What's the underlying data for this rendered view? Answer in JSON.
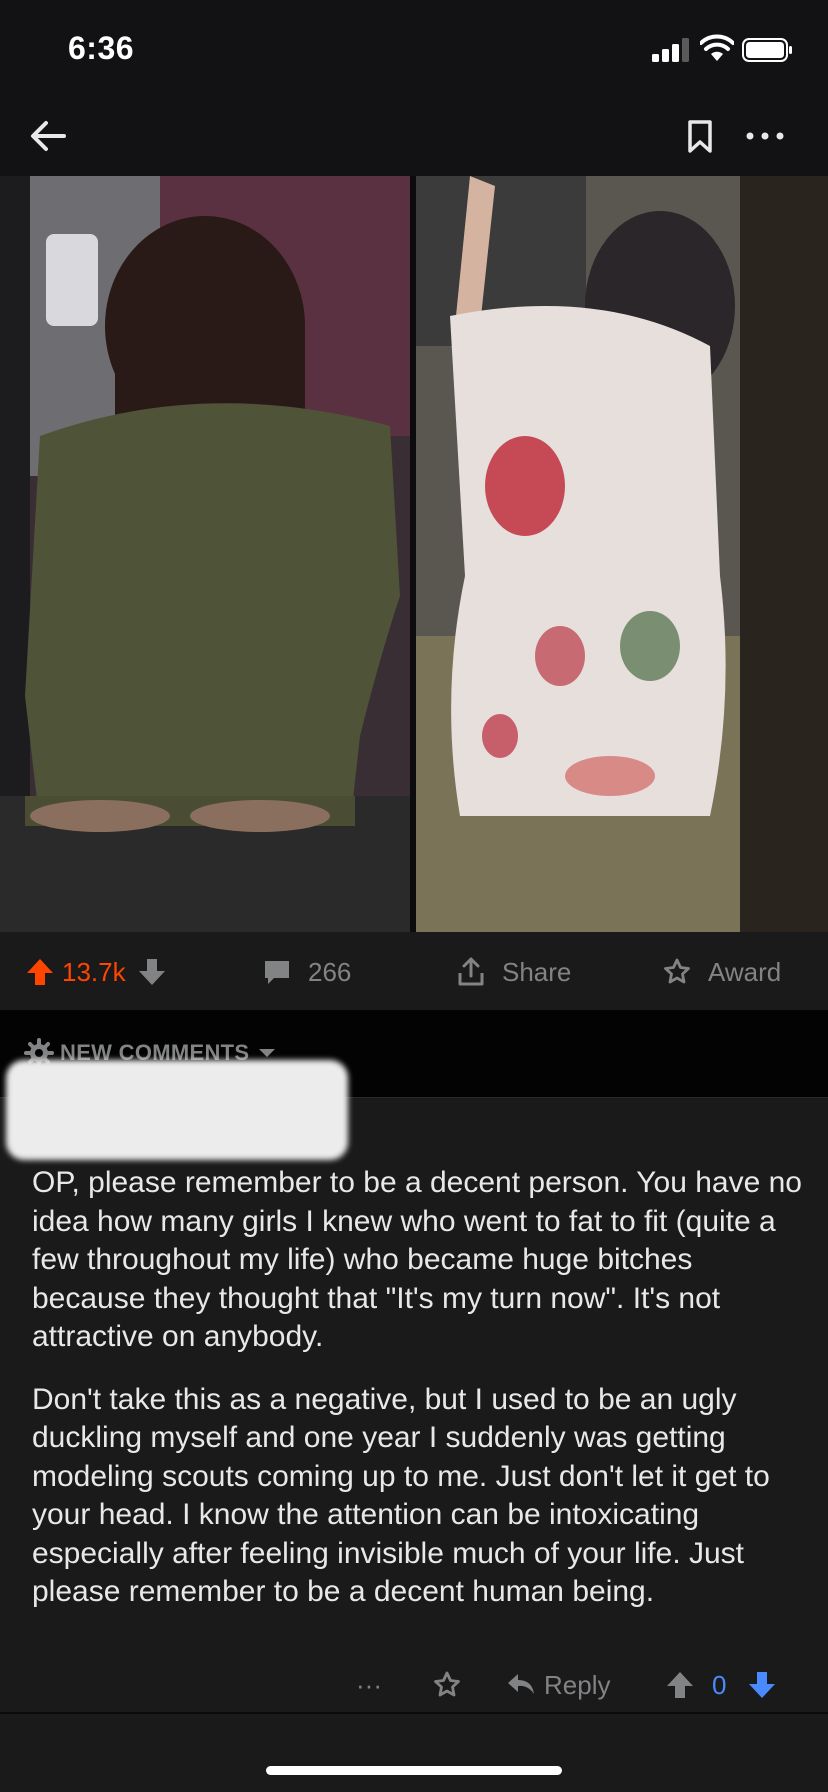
{
  "status_bar": {
    "time": "6:36"
  },
  "post": {
    "score": "13.7k",
    "comment_count": "266",
    "share_label": "Share",
    "award_label": "Award"
  },
  "comments_header": {
    "sort_label": "NEW COMMENTS"
  },
  "comment": {
    "paragraphs": [
      "OP, please remember to be a decent person. You have no idea how many girls I knew who went to fat to fit (quite a few throughout my life) who became huge bitches because they thought that \"It's my turn now\". It's not attractive on anybody.",
      "Don't take this as a negative, but I used to be an ugly duckling myself and one year I suddenly was getting modeling scouts coming up to me. Just don't let it get to your head. I know the attention can be intoxicating especially after feeling invisible much of your life. Just please remember to be a decent human being."
    ],
    "more_label": "···",
    "reply_label": "Reply",
    "score": "0"
  },
  "colors": {
    "upvote": "#ff4500",
    "downvote_active": "#4a8aff",
    "background": "#1a1a1b",
    "muted": "#818384"
  },
  "icons": [
    "back-arrow-icon",
    "bookmark-icon",
    "more-icon",
    "upvote-icon",
    "downvote-icon",
    "comment-icon",
    "share-icon",
    "award-icon",
    "gear-icon",
    "caret-down-icon",
    "reply-icon",
    "double-chevron-down-icon"
  ]
}
